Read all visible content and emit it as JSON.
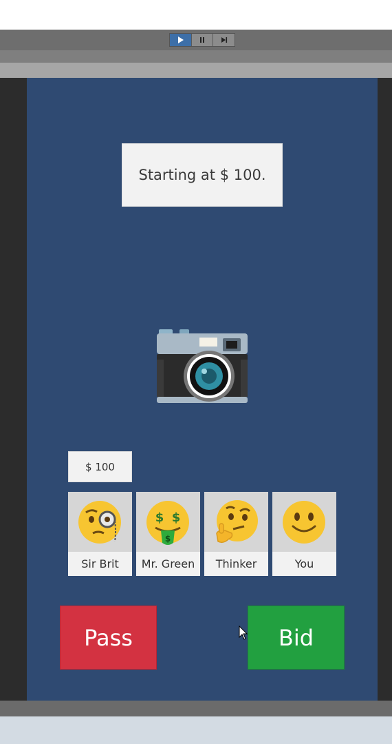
{
  "editor": {
    "play_controls": [
      {
        "icon": "play-icon",
        "active": true
      },
      {
        "icon": "pause-icon",
        "active": false
      },
      {
        "icon": "step-icon",
        "active": false
      }
    ]
  },
  "game": {
    "message": "Starting at $ 100.",
    "item_icon": "camera-icon",
    "current_bid": "$ 100",
    "players": [
      {
        "name": "Sir Brit",
        "icon": "monocle-face-icon"
      },
      {
        "name": "Mr. Green",
        "icon": "money-mouth-face-icon"
      },
      {
        "name": "Thinker",
        "icon": "thinking-face-icon"
      },
      {
        "name": "You",
        "icon": "smiling-face-icon"
      }
    ],
    "pass_label": "Pass",
    "bid_label": "Bid"
  },
  "colors": {
    "background": "#2f4a72",
    "pass": "#d33241",
    "bid": "#22a040",
    "play_active": "#3d6fa8"
  }
}
